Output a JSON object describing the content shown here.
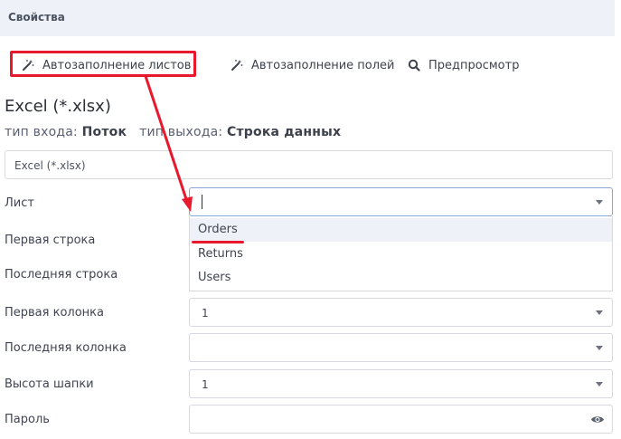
{
  "header": {
    "title": "Свойства"
  },
  "toolbar": {
    "autofill_sheets": "Автозаполнение листов",
    "autofill_fields": "Автозаполнение полей",
    "preview": "Предпросмотр"
  },
  "section": {
    "title": "Excel (*.xlsx)",
    "input_type_label": "тип входа:",
    "input_type_value": "Поток",
    "output_type_label": "тип выхода:",
    "output_type_value": "Строка данных",
    "name_value": "Excel (*.xlsx)"
  },
  "fields": [
    {
      "label": "Лист",
      "value": ""
    },
    {
      "label": "Первая строка",
      "value": ""
    },
    {
      "label": "Последняя строка",
      "value": ""
    },
    {
      "label": "Первая колонка",
      "value": "1"
    },
    {
      "label": "Последняя колонка",
      "value": ""
    },
    {
      "label": "Высота шапки",
      "value": "1"
    },
    {
      "label": "Пароль",
      "value": ""
    }
  ],
  "dropdown": {
    "options": [
      "Orders",
      "Returns",
      "Users"
    ]
  },
  "colors": {
    "highlight": "#e8192c",
    "header_bg": "#eef1f8",
    "border": "#d6d9e0"
  }
}
